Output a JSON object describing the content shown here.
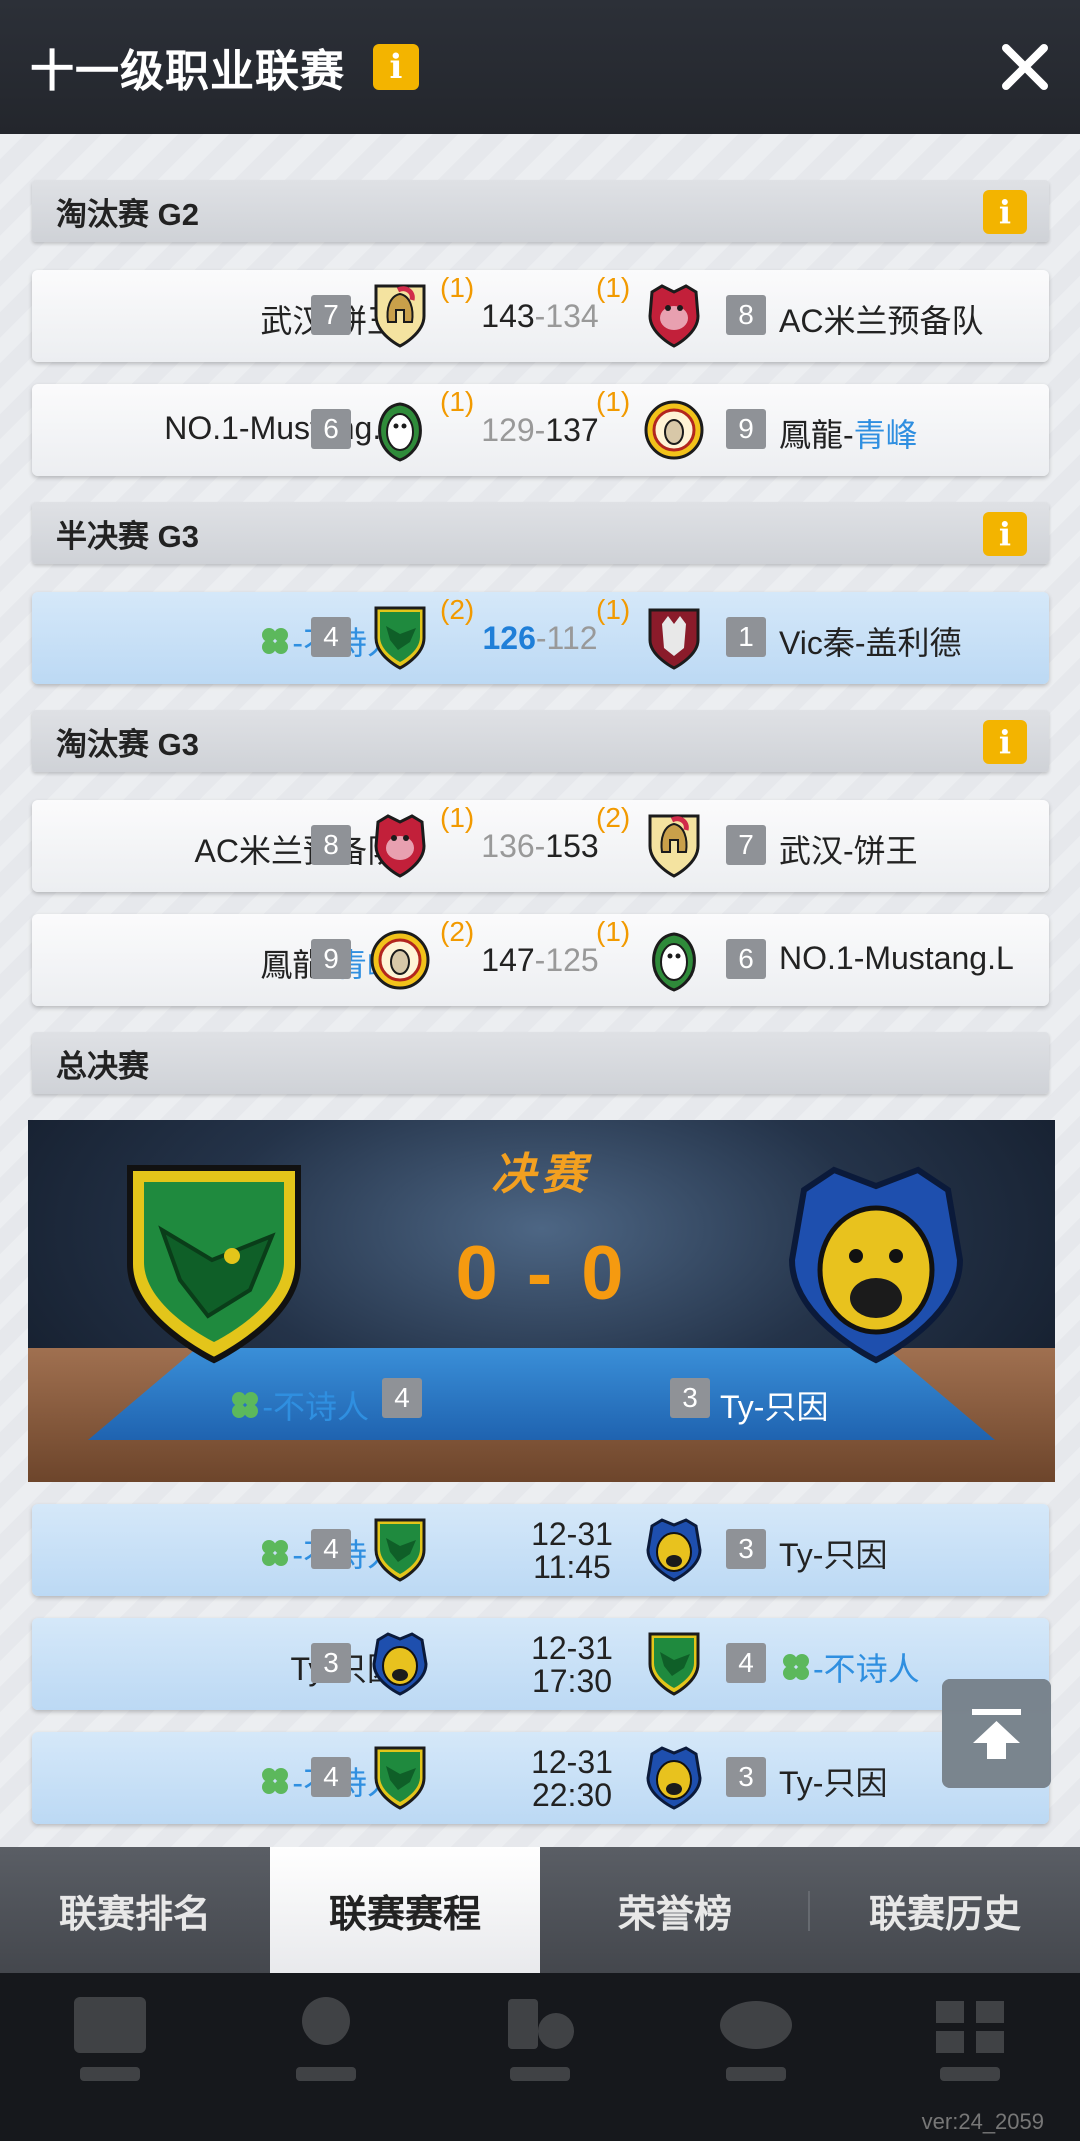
{
  "header": {
    "title": "十一级职业联赛",
    "info_icon": "info-icon",
    "close_icon": "close-icon"
  },
  "sections": [
    {
      "title": "淘汰赛 G2",
      "matches": [
        {
          "home": "武汉-饼王",
          "home_seed": "7",
          "home_wins": "(1)",
          "home_score": "143",
          "away_score": "134",
          "away_wins": "(1)",
          "away_seed": "8",
          "away": "AC米兰预备队"
        },
        {
          "home": "NO.1-Mustang.L",
          "home_seed": "6",
          "home_wins": "(1)",
          "home_score": "129",
          "away_score": "137",
          "away_wins": "(1)",
          "away_seed": "9",
          "away_prefix": "鳳龍-",
          "away_suffix": "青峰"
        }
      ]
    },
    {
      "title": "半决赛 G3",
      "matches": [
        {
          "home": "-不诗人",
          "home_seed": "4",
          "home_wins": "(2)",
          "home_score": "126",
          "away_score": "112",
          "away_wins": "(1)",
          "away_seed": "1",
          "away": "Vic秦-盖利德"
        }
      ]
    },
    {
      "title": "淘汰赛 G3",
      "matches": [
        {
          "home": "AC米兰预备队",
          "home_seed": "8",
          "home_wins": "(1)",
          "home_score": "136",
          "away_score": "153",
          "away_wins": "(2)",
          "away_seed": "7",
          "away": "武汉-饼王"
        },
        {
          "home_prefix": "鳳龍-",
          "home_suffix": "青峰",
          "home_seed": "9",
          "home_wins": "(2)",
          "home_score": "147",
          "away_score": "125",
          "away_wins": "(1)",
          "away_seed": "6",
          "away": "NO.1-Mustang.L"
        }
      ]
    },
    {
      "title": "总决赛"
    }
  ],
  "finals": {
    "title": "决赛",
    "score": "0 - 0",
    "home": "-不诗人",
    "home_seed": "4",
    "away": "Ty-只因",
    "away_seed": "3",
    "games": [
      {
        "home": "-不诗人",
        "home_seed": "4",
        "date": "12-31",
        "time": "11:45",
        "away_seed": "3",
        "away": "Ty-只因"
      },
      {
        "home": "Ty-只因",
        "home_seed": "3",
        "date": "12-31",
        "time": "17:30",
        "away_seed": "4",
        "away": "-不诗人"
      },
      {
        "home": "-不诗人",
        "home_seed": "4",
        "date": "12-31",
        "time": "22:30",
        "away_seed": "3",
        "away": "Ty-只因"
      }
    ]
  },
  "tabs": [
    "联赛排名",
    "联赛赛程",
    "荣誉榜",
    "联赛历史"
  ],
  "active_tab": "联赛赛程",
  "version": "ver:24_2059",
  "colors": {
    "accent_orange": "#f29a00",
    "highlight_blue": "#2f8fe0",
    "info_yellow": "#f3b400"
  }
}
